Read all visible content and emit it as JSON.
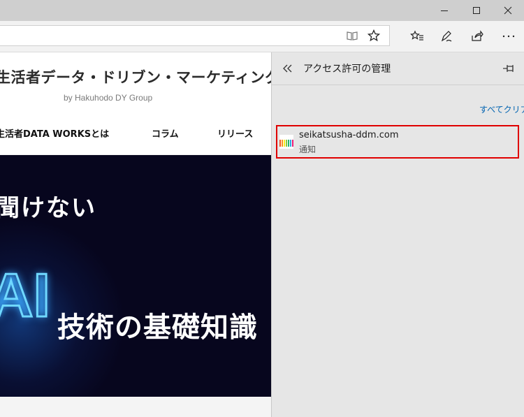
{
  "window": {
    "controls": {
      "minimize": "minimize-icon",
      "maximize": "maximize-icon",
      "close": "close-icon"
    }
  },
  "toolbar": {
    "reading_view": "reading-view-icon",
    "favorite_star": "star-icon",
    "favorites": "favorites-icon",
    "web_note": "pen-icon",
    "share": "share-icon",
    "more": "more-icon"
  },
  "page": {
    "site_title": "生活者データ・ドリブン・マーケティング通信",
    "site_subtitle": "by Hakuhodo DY Group",
    "nav": [
      "生活者DATA WORKSとは",
      "コラム",
      "リリース"
    ],
    "hero": {
      "line1": "聞けない",
      "ai_text": "AI",
      "line2": "技術の基礎知識"
    }
  },
  "panel": {
    "title": "アクセス許可の管理",
    "clear_all": "すべてクリア",
    "entries": [
      {
        "domain": "seikatsusha-ddm.com",
        "permission": "通知"
      }
    ]
  },
  "colors": {
    "accent_link": "#0063b1",
    "highlight_border": "#e00000",
    "hero_bg": "#07061e"
  }
}
